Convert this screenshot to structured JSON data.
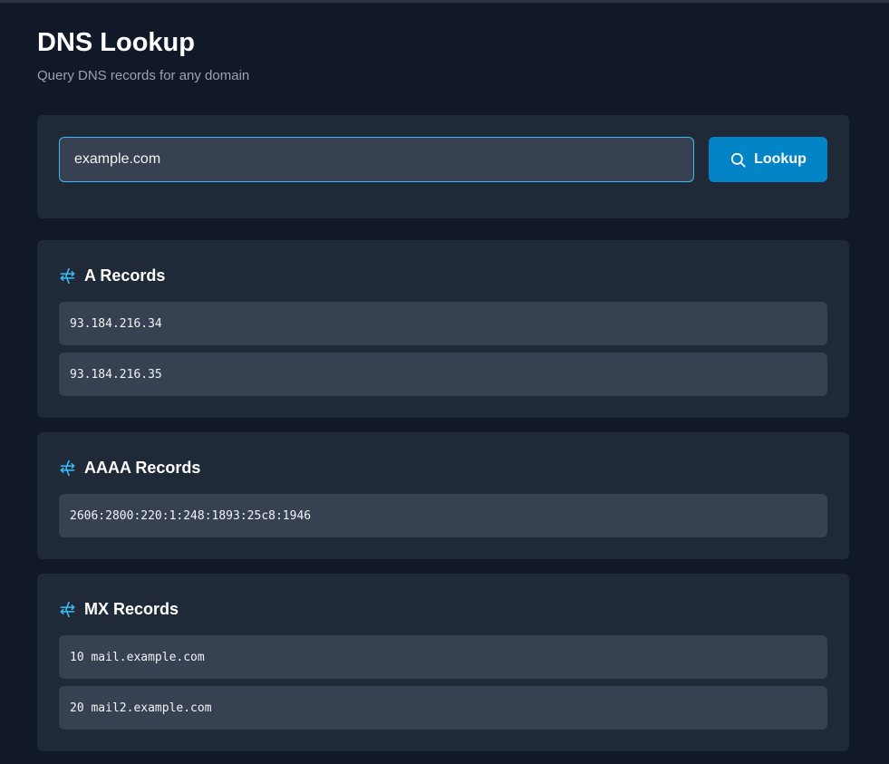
{
  "header": {
    "title": "DNS Lookup",
    "subtitle": "Query DNS records for any domain"
  },
  "search": {
    "value": "example.com",
    "button_label": "Lookup",
    "button_icon": "search-icon"
  },
  "colors": {
    "background": "#111827",
    "card": "#1f2937",
    "record": "#374151",
    "accent": "#0284c7",
    "icon": "#38bdf8"
  },
  "sections": [
    {
      "icon": "network-icon",
      "title": "A Records",
      "records": [
        "93.184.216.34",
        "93.184.216.35"
      ]
    },
    {
      "icon": "network-icon",
      "title": "AAAA Records",
      "records": [
        "2606:2800:220:1:248:1893:25c8:1946"
      ]
    },
    {
      "icon": "network-icon",
      "title": "MX Records",
      "records": [
        "10 mail.example.com",
        "20 mail2.example.com"
      ]
    }
  ]
}
